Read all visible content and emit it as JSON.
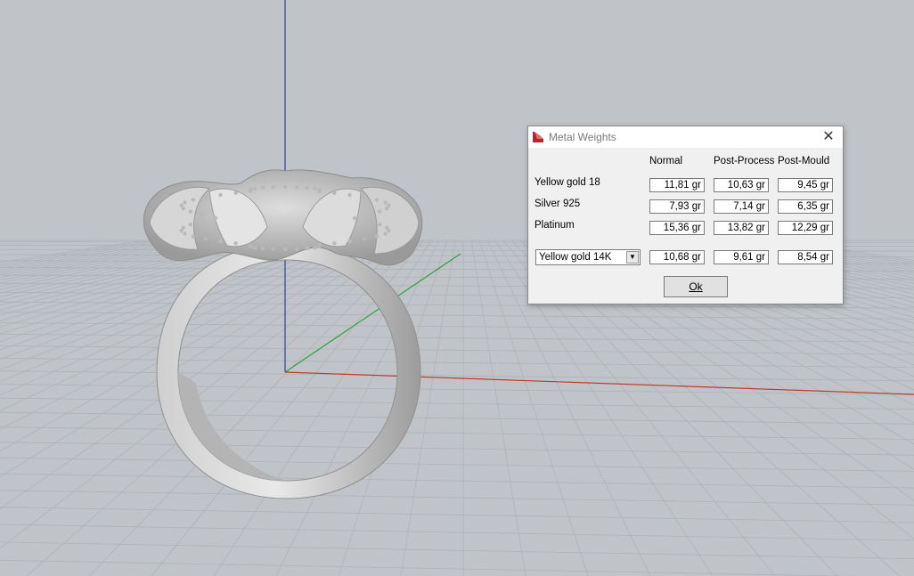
{
  "dialog": {
    "title": "Metal Weights",
    "close_glyph": "✕",
    "columns": [
      "Normal",
      "Post-Process",
      "Post-Mould"
    ],
    "rows": [
      {
        "label": "Yellow gold 18",
        "values": [
          "11,81 gr",
          "10,63 gr",
          "9,45 gr"
        ]
      },
      {
        "label": "Silver 925",
        "values": [
          "7,93 gr",
          "7,14 gr",
          "6,35 gr"
        ]
      },
      {
        "label": "Platinum",
        "values": [
          "15,36 gr",
          "13,82 gr",
          "12,29 gr"
        ]
      }
    ],
    "custom_row": {
      "selected_metal": "Yellow gold 14K",
      "values": [
        "10,68 gr",
        "9,61 gr",
        "8,54 gr"
      ]
    },
    "ok_label": "Ok",
    "icons": {
      "app": "metal-weights-app-icon",
      "close": "close-icon",
      "dropdown": "chevron-down-icon"
    }
  },
  "viewport": {
    "background_color": "#c0c4c9",
    "axis_colors": {
      "x": "#c0392b",
      "y": "#2e9e3e",
      "z": "#3040a0"
    }
  }
}
